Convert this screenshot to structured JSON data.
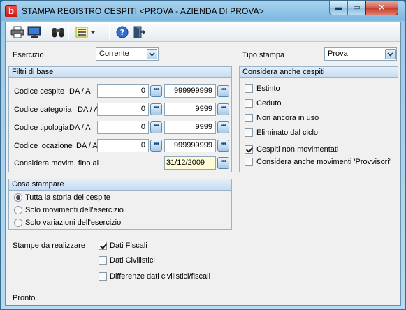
{
  "window": {
    "title": "STAMPA REGISTRO CESPITI <PROVA - AZIENDA DI PROVA>",
    "app_icon_letter": "b",
    "min_glyph": "▬",
    "max_glyph": "▭",
    "close_glyph": "✕"
  },
  "toolbar": {
    "items": [
      "print-icon",
      "preview-icon",
      "binoculars-icon",
      "list-options-icon",
      "help-icon",
      "exit-icon"
    ]
  },
  "header": {
    "esercizio_label": "Esercizio",
    "esercizio_value": "Corrente",
    "tipo_stampa_label": "Tipo stampa",
    "tipo_stampa_value": "Prova"
  },
  "filtri": {
    "title": "Filtri di base",
    "rows": [
      {
        "label": "Codice cespite",
        "range": "DA / A",
        "from": "0",
        "to": "999999999"
      },
      {
        "label": "Codice categoria",
        "range": "DA / A",
        "from": "0",
        "to": "9999"
      },
      {
        "label": "Codice tipologia",
        "range": "DA / A",
        "from": "0",
        "to": "9999"
      },
      {
        "label": "Codice locazione",
        "range": "DA / A",
        "from": "0",
        "to": "999999999"
      }
    ],
    "movim_label": "Considera movim. fino al",
    "movim_date": "31/12/2009"
  },
  "considera": {
    "title": "Considera anche cespiti",
    "options": [
      {
        "label": "Estinto",
        "checked": false
      },
      {
        "label": "Ceduto",
        "checked": false
      },
      {
        "label": "Non ancora in uso",
        "checked": false
      },
      {
        "label": "Eliminato dal ciclo",
        "checked": false
      },
      {
        "label": "Cespiti non movimentati",
        "checked": true
      },
      {
        "label": "Considera anche movimenti 'Provvisori'",
        "checked": false
      }
    ]
  },
  "cosa": {
    "title": "Cosa stampare",
    "options": [
      {
        "label": "Tutta la storia del cespite",
        "selected": true
      },
      {
        "label": "Solo movimenti dell'esercizio",
        "selected": false
      },
      {
        "label": "Solo variazioni dell'esercizio",
        "selected": false
      }
    ]
  },
  "stampe": {
    "label": "Stampe da realizzare",
    "options": [
      {
        "label": "Dati Fiscali",
        "checked": true
      },
      {
        "label": "Dati Civilistici",
        "checked": false
      },
      {
        "label": "Differenze dati civilistici/fiscali",
        "checked": false
      }
    ]
  },
  "status": "Pronto.",
  "dots_glyph": "•••",
  "colors": {
    "title_bg": "#7db8df",
    "group_header": "#c6dcf0",
    "date_bg": "#fffbd6"
  }
}
